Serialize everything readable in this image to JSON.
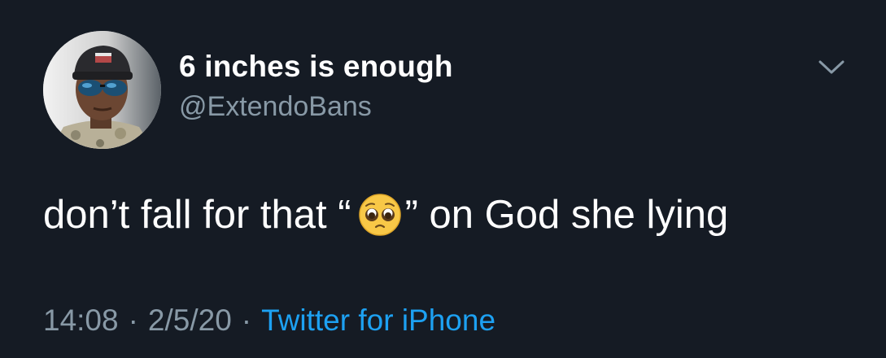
{
  "tweet": {
    "display_name": "6 inches is enough",
    "handle": "@ExtendoBans",
    "text_before_emoji": "don’t fall for that “",
    "emoji_icon": "pleading-face-emoji",
    "text_after_emoji": "” on God she lying",
    "time": "14:08",
    "separator": "·",
    "date": "2/5/20",
    "source": "Twitter for iPhone"
  },
  "colors": {
    "background": "#151b24",
    "text_primary": "#ffffff",
    "text_secondary": "#8899a6",
    "link": "#1da1f2"
  },
  "icons": {
    "menu": "chevron-down-icon",
    "avatar": "profile-photo"
  }
}
